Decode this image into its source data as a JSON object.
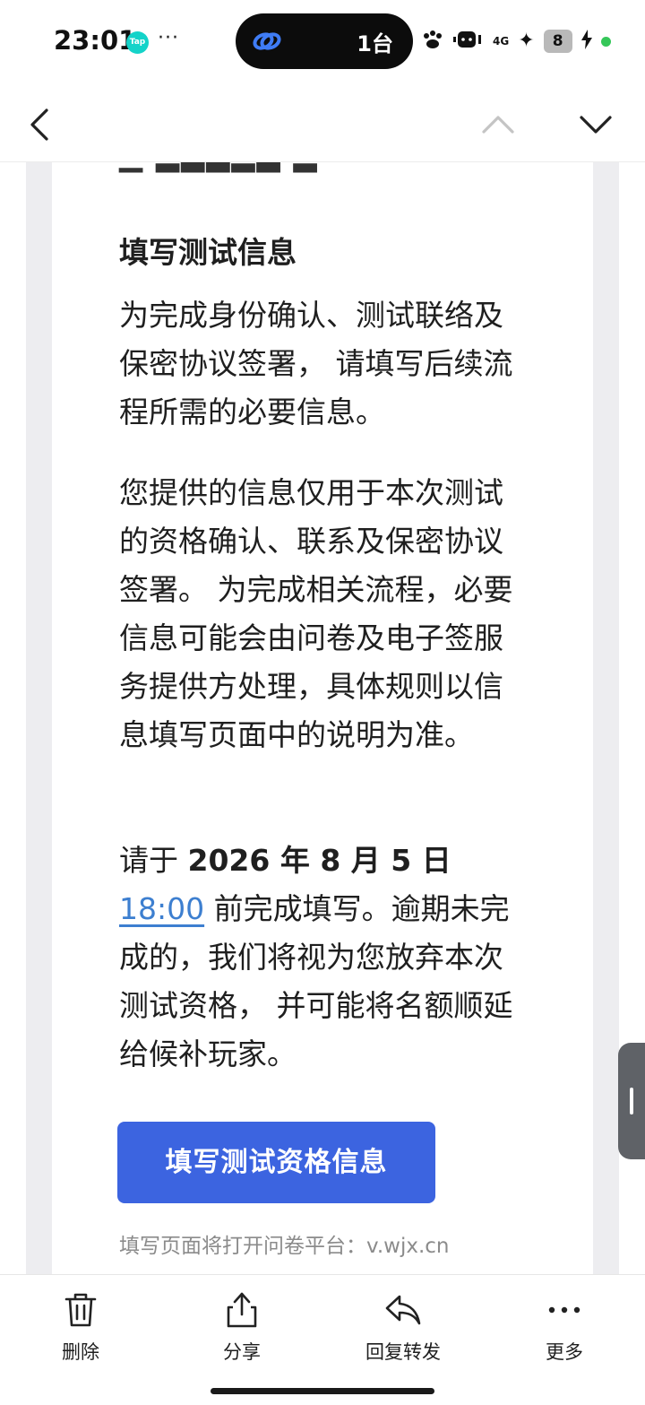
{
  "status_bar": {
    "time": "23:01",
    "tap_badge": "Tap",
    "more_dots": "···",
    "island_count": "1台",
    "network": "4G",
    "battery": "8"
  },
  "nav": {
    "icons": [
      "chevron-left-icon",
      "chevron-up-icon",
      "chevron-down-icon"
    ]
  },
  "email": {
    "clipped_line": "▁ ▂▃▃▂▃ ▂",
    "section_title": "填写测试信息",
    "para1": "为完成身份确认、测试联络及保密协议签署， 请填写后续流程所需的必要信息。",
    "para2": "您提供的信息仅用于本次测试的资格确认、联系及保密协议签署。 为完成相关流程，必要信息可能会由问卷及电子签服务提供方处理，具体规则以信息填写页面中的说明为准。",
    "deadline": {
      "prefix": "请于 ",
      "date": "2026 年 8 月 5 日",
      "time": "18:00",
      "rest": " 前完成填写。逾期未完成的，我们将视为您放弃本次测试资格， 并可能将名额顺延给候补玩家。"
    },
    "cta_label": "填写测试资格信息",
    "footnote": "填写页面将打开问卷平台：v.wjx.cn"
  },
  "toolbar": {
    "delete": "删除",
    "share": "分享",
    "reply_forward": "回复转发",
    "more": "更多"
  },
  "colors": {
    "accent": "#3c64e0",
    "link": "#3d7fd0",
    "gutter": "#ededf0"
  }
}
